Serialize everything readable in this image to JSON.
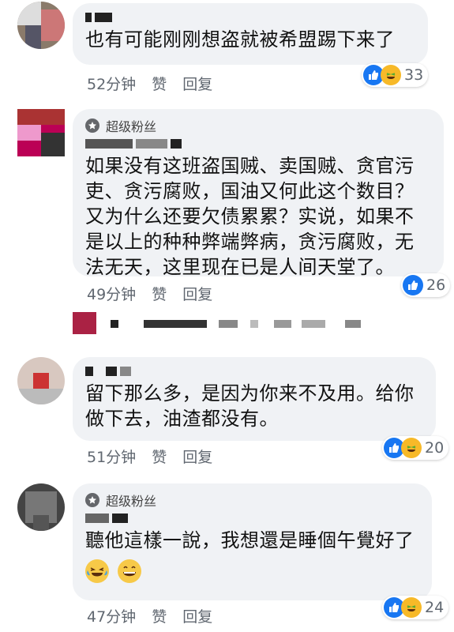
{
  "colors": {
    "like": "#1877f2",
    "haha": "#f7b928",
    "bubble": "#f0f2f5",
    "meta": "#606770"
  },
  "comments": [
    {
      "text": "也有可能刚刚想盗就被希盟踢下来了",
      "time": "52分钟",
      "like_label": "赞",
      "reply_label": "回复",
      "reactions": [
        "like-icon",
        "haha-icon"
      ],
      "count": "33"
    },
    {
      "badge": "超级粉丝",
      "text": "如果没有这班盗国贼、卖国贼、贪官污吏、贪污腐败，国油又何此这个数目？又为什么还要欠债累累？实说，如果不是以上的种种弊端弊病，贪污腐败，无法无天，这里现在已是人间天堂了。",
      "time": "49分钟",
      "like_label": "赞",
      "reply_label": "回复",
      "reactions": [
        "like-icon"
      ],
      "count": "26"
    },
    {
      "text": "留下那么多，是因为你来不及用。给你做下去，油渣都没有。",
      "time": "51分钟",
      "like_label": "赞",
      "reply_label": "回复",
      "reactions": [
        "like-icon",
        "haha-icon"
      ],
      "count": "20"
    },
    {
      "badge": "超级粉丝",
      "text": "聽他這樣一說，我想還是睡個午覺好了",
      "emojis": [
        "crying-laughing-emoji",
        "grinning-emoji"
      ],
      "time": "47分钟",
      "like_label": "赞",
      "reply_label": "回复",
      "reactions": [
        "like-icon",
        "haha-icon"
      ],
      "count": "24"
    }
  ]
}
